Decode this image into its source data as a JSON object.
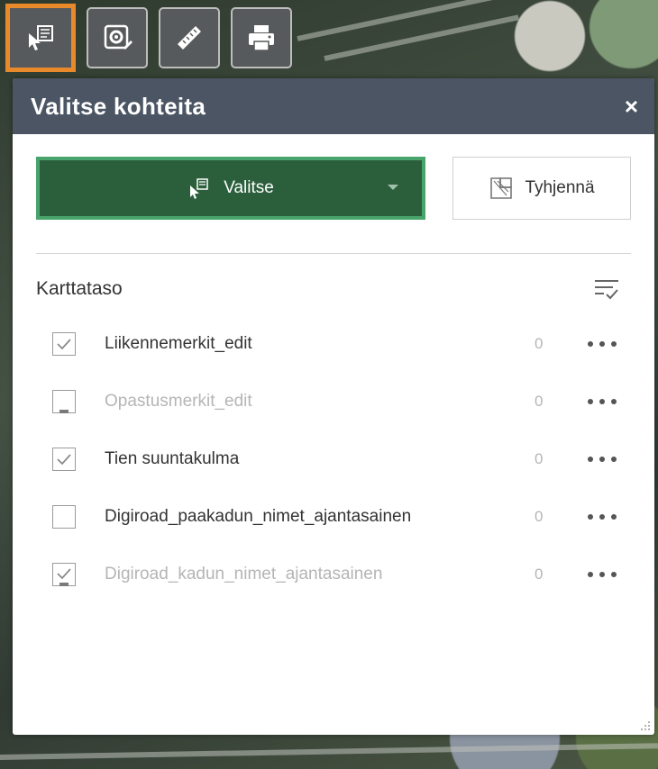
{
  "toolbar": {
    "tools": [
      {
        "name": "select-tool",
        "icon": "select-cursor-icon",
        "active": true
      },
      {
        "name": "settings-tool",
        "icon": "gear-edit-icon",
        "active": false
      },
      {
        "name": "measure-tool",
        "icon": "ruler-icon",
        "active": false
      },
      {
        "name": "print-tool",
        "icon": "printer-icon",
        "active": false
      }
    ]
  },
  "panel": {
    "title": "Valitse kohteita",
    "close_glyph": "×",
    "select_button_label": "Valitse",
    "clear_button_label": "Tyhjennä",
    "layers_title": "Karttataso",
    "layers": [
      {
        "name": "Liikennemerkit_edit",
        "count": "0",
        "checked": true,
        "disabled": false
      },
      {
        "name": "Opastusmerkit_edit",
        "count": "0",
        "checked": false,
        "disabled": true
      },
      {
        "name": "Tien suuntakulma",
        "count": "0",
        "checked": true,
        "disabled": false
      },
      {
        "name": "Digiroad_paakadun_nimet_ajantasainen",
        "count": "0",
        "checked": false,
        "disabled": false
      },
      {
        "name": "Digiroad_kadun_nimet_ajantasainen",
        "count": "0",
        "checked": true,
        "disabled": true
      }
    ]
  },
  "colors": {
    "active_tool_border": "#e88a2c",
    "header_bg": "#4b5563",
    "select_button_bg": "#2b5f3c",
    "select_button_border": "#48a46a"
  }
}
